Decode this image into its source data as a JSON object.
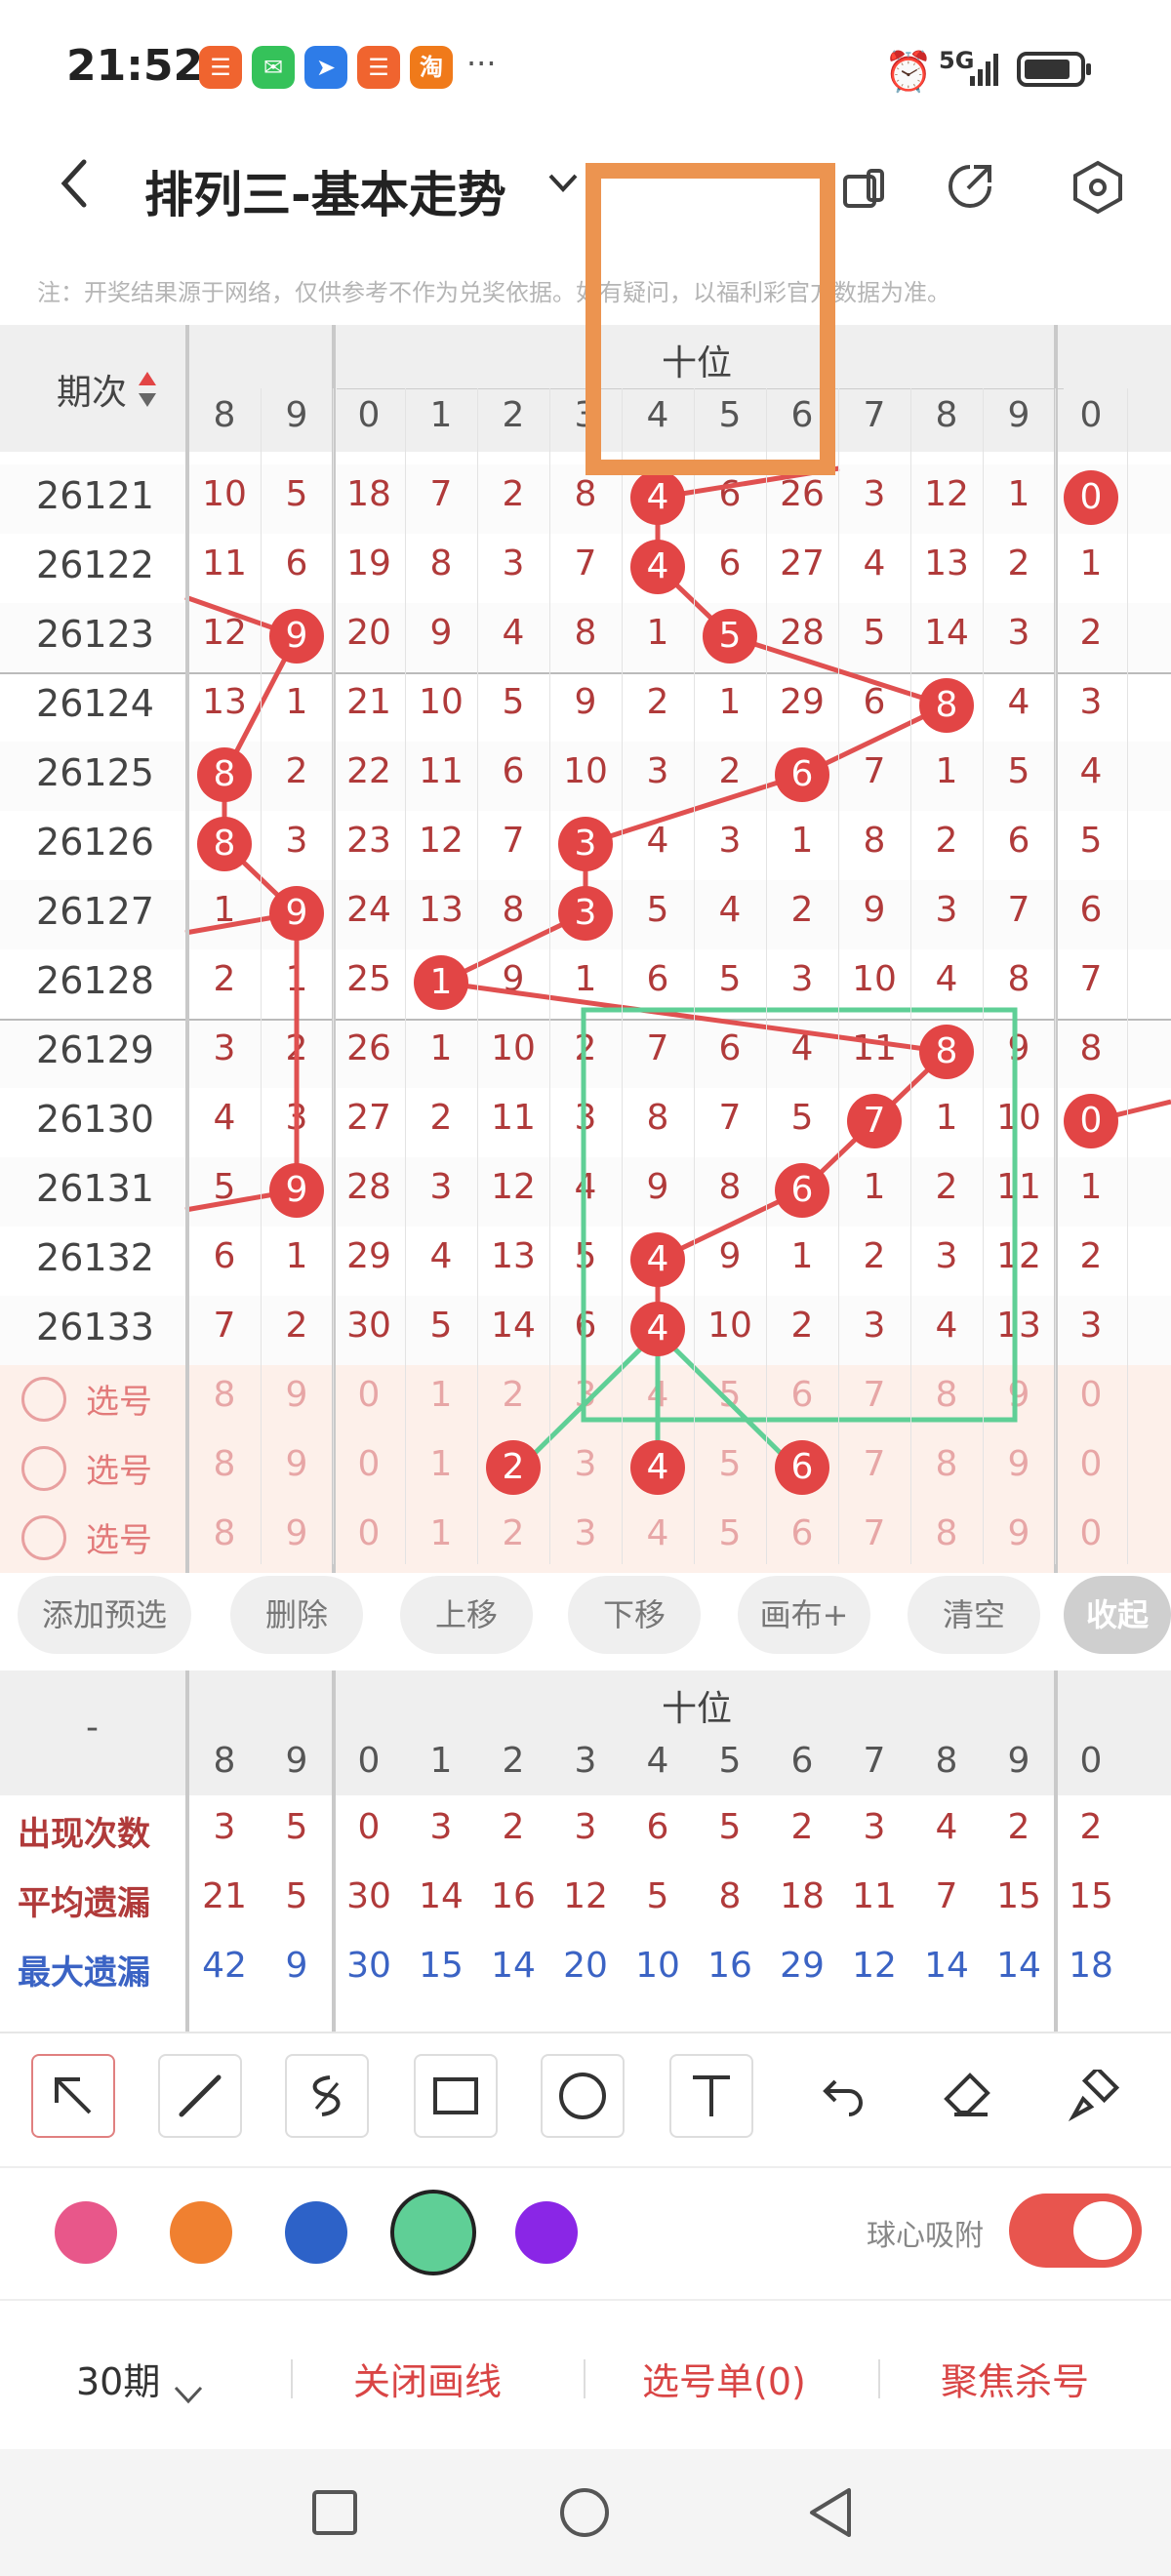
{
  "status_bar": {
    "time": "21:52",
    "network": "5G"
  },
  "header": {
    "title": "排列三-基本走势",
    "note": "注：开奖结果源于网络，仅供参考不作为兑奖依据。如有疑问，以福利彩官方数据为准。"
  },
  "grid": {
    "period_header": "期次",
    "group_label": "十位",
    "digits": [
      "8",
      "9",
      "0",
      "1",
      "2",
      "3",
      "4",
      "5",
      "6",
      "7",
      "8",
      "9",
      "0"
    ],
    "rows": [
      {
        "period": "26121",
        "cells": [
          "10",
          "5",
          "18",
          "7",
          "2",
          "8",
          "4",
          "6",
          "26",
          "3",
          "12",
          "1",
          "0"
        ]
      },
      {
        "period": "26122",
        "cells": [
          "11",
          "6",
          "19",
          "8",
          "3",
          "7",
          "4",
          "6",
          "27",
          "4",
          "13",
          "2",
          "1"
        ]
      },
      {
        "period": "26123",
        "cells": [
          "12",
          "9",
          "20",
          "9",
          "4",
          "8",
          "1",
          "5",
          "28",
          "5",
          "14",
          "3",
          "2"
        ]
      },
      {
        "period": "26124",
        "cells": [
          "13",
          "1",
          "21",
          "10",
          "5",
          "9",
          "2",
          "1",
          "29",
          "6",
          "8",
          "4",
          "3"
        ]
      },
      {
        "period": "26125",
        "cells": [
          "8",
          "2",
          "22",
          "11",
          "6",
          "10",
          "3",
          "2",
          "6",
          "7",
          "1",
          "5",
          "4"
        ]
      },
      {
        "period": "26126",
        "cells": [
          "8",
          "3",
          "23",
          "12",
          "7",
          "3",
          "4",
          "3",
          "1",
          "8",
          "2",
          "6",
          "5"
        ]
      },
      {
        "period": "26127",
        "cells": [
          "1",
          "9",
          "24",
          "13",
          "8",
          "3",
          "5",
          "4",
          "2",
          "9",
          "3",
          "7",
          "6"
        ]
      },
      {
        "period": "26128",
        "cells": [
          "2",
          "1",
          "25",
          "1",
          "9",
          "1",
          "6",
          "5",
          "3",
          "10",
          "4",
          "8",
          "7"
        ]
      },
      {
        "period": "26129",
        "cells": [
          "3",
          "2",
          "26",
          "1",
          "10",
          "2",
          "7",
          "6",
          "4",
          "11",
          "8",
          "9",
          "8"
        ]
      },
      {
        "period": "26130",
        "cells": [
          "4",
          "3",
          "27",
          "2",
          "11",
          "3",
          "8",
          "7",
          "5",
          "7",
          "1",
          "10",
          "0"
        ]
      },
      {
        "period": "26131",
        "cells": [
          "5",
          "9",
          "28",
          "3",
          "12",
          "4",
          "9",
          "8",
          "6",
          "1",
          "2",
          "11",
          "1"
        ]
      },
      {
        "period": "26132",
        "cells": [
          "6",
          "1",
          "29",
          "4",
          "13",
          "5",
          "4",
          "9",
          "1",
          "2",
          "3",
          "12",
          "2"
        ]
      },
      {
        "period": "26133",
        "cells": [
          "7",
          "2",
          "30",
          "5",
          "14",
          "6",
          "4",
          "10",
          "2",
          "3",
          "4",
          "13",
          "3"
        ]
      }
    ],
    "select_label": "选号",
    "select_rows": 3
  },
  "actions": [
    "添加预选",
    "删除",
    "上移",
    "下移",
    "画布+",
    "清空",
    "收起"
  ],
  "stats": {
    "dash": "-",
    "group_label": "十位",
    "rows": [
      {
        "label": "出现次数",
        "color": "#b03a3a",
        "values": [
          "3",
          "5",
          "0",
          "3",
          "2",
          "3",
          "6",
          "5",
          "2",
          "3",
          "4",
          "2",
          "2"
        ]
      },
      {
        "label": "平均遗漏",
        "color": "#b03a3a",
        "values": [
          "21",
          "5",
          "30",
          "14",
          "16",
          "12",
          "5",
          "8",
          "18",
          "11",
          "7",
          "15",
          "15"
        ]
      },
      {
        "label": "最大遗漏",
        "color": "#3b63c4",
        "values": [
          "42",
          "9",
          "30",
          "15",
          "14",
          "20",
          "10",
          "16",
          "29",
          "12",
          "14",
          "14",
          "18"
        ]
      }
    ]
  },
  "toolbar": {
    "tools": [
      "pointer-icon",
      "line-icon",
      "freehand-icon",
      "rectangle-icon",
      "circle-icon",
      "text-icon",
      "undo-icon",
      "eraser-icon",
      "brush-icon"
    ],
    "colors": [
      "#e8578a",
      "#f08030",
      "#2d62c8",
      "#5fcf96",
      "#8a26e6"
    ],
    "snap_label": "球心吸附",
    "snap_on": true
  },
  "bottom": {
    "period_select": "30期",
    "close_lines": "关闭画线",
    "selection_list": "选号单(0)",
    "focus_kill": "聚焦杀号"
  },
  "accent": "#e24545"
}
